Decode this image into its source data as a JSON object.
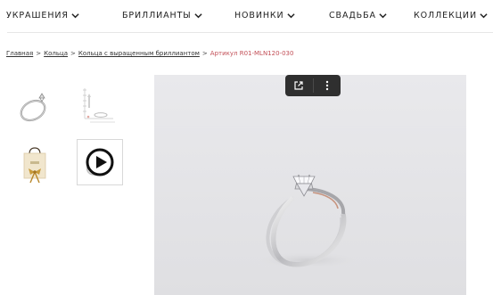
{
  "nav": {
    "items": [
      {
        "label": "УКРАШЕНИЯ"
      },
      {
        "label": "БРИЛЛИАНТЫ"
      },
      {
        "label": "НОВИНКИ"
      },
      {
        "label": "СВАДЬБА"
      },
      {
        "label": "КОЛЛЕКЦИИ"
      }
    ]
  },
  "breadcrumb": {
    "items": [
      "Главная",
      "Кольца",
      "Кольца с выращенным бриллиантом"
    ],
    "separator": ">",
    "current": "Артикул R01-MLN120-030"
  },
  "thumbnails": {
    "items": [
      {
        "icon": "ring-icon"
      },
      {
        "icon": "size-chart-icon"
      },
      {
        "icon": "gift-bag-icon"
      },
      {
        "icon": "play-icon"
      }
    ]
  },
  "toolbar": {
    "icons": [
      "open-external-icon",
      "more-vertical-icon"
    ]
  },
  "colors": {
    "accent": "#c24f57",
    "toolbar_bg": "#2f2f2f",
    "image_bg": "#e6e6e9"
  }
}
